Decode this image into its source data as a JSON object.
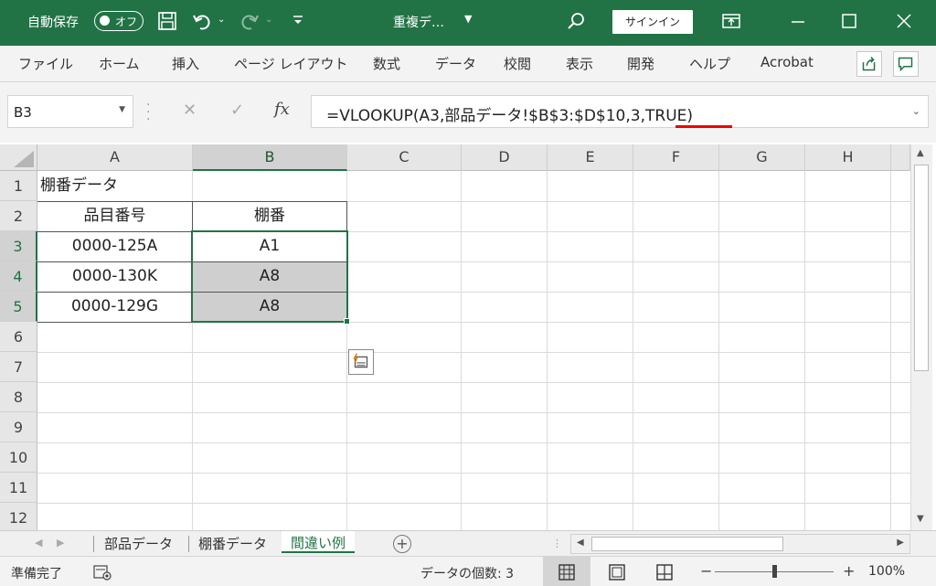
{
  "titlebar": {
    "autosave_label": "自動保存",
    "autosave_state": "オフ",
    "doc_name": "重複デ…",
    "signin_label": "サインイン",
    "bg_color": "#217346"
  },
  "ribbon": {
    "tabs": [
      "ファイル",
      "ホーム",
      "挿入",
      "ページ レイアウト",
      "数式",
      "データ",
      "校閲",
      "表示",
      "開発",
      "ヘルプ",
      "Acrobat"
    ]
  },
  "formula_bar": {
    "name_box": "B3",
    "formula": "=VLOOKUP(A3,部品データ!$B$3:$D$10,3,TRUE)",
    "fx_label": "fx",
    "underline_color": "#e00000"
  },
  "grid": {
    "columns": [
      "A",
      "B",
      "C",
      "D",
      "E",
      "F",
      "G",
      "H"
    ],
    "rows": [
      "1",
      "2",
      "3",
      "4",
      "5",
      "6",
      "7",
      "8",
      "9",
      "10",
      "11",
      "12"
    ],
    "cells": {
      "A1": "棚番データ",
      "A2": "品目番号",
      "B2": "棚番",
      "A3": "0000-125A",
      "B3": "A1",
      "A4": "0000-130K",
      "B4": "A8",
      "A5": "0000-129G",
      "B5": "A8"
    },
    "active_cell": "B3",
    "selection": "B3:B5"
  },
  "sheet_tabs": {
    "tabs": [
      "部品データ",
      "棚番データ",
      "間違い例"
    ],
    "active": "間違い例",
    "add_label": "+"
  },
  "status_bar": {
    "ready": "準備完了",
    "count": "データの個数: 3",
    "zoom_minus": "−",
    "zoom_plus": "+",
    "zoom": "100%"
  }
}
